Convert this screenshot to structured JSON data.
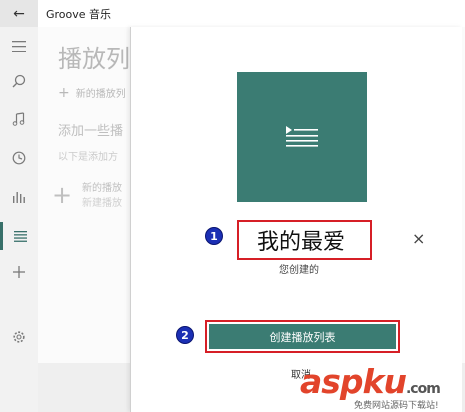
{
  "titlebar": {
    "back_glyph": "←",
    "app_title": "Groove 音乐"
  },
  "rail": {
    "icons": [
      "hamburger-icon",
      "search-icon",
      "music-note-icon",
      "clock-icon",
      "bar-chart-icon",
      "playlist-icon",
      "plus-icon",
      "gear-icon"
    ]
  },
  "background": {
    "title": "播放列",
    "new_playlist": "新的播放列",
    "add_heading": "添加一些播",
    "add_desc": "以下是添加方",
    "item_title": "新的播放",
    "item_sub": "新建播放"
  },
  "dialog": {
    "name_value": "我的最爱",
    "creator_label": "您创建的",
    "create_button": "创建播放列表",
    "cancel_label": "取消",
    "close_glyph": "×",
    "cover_color": "#3b7c73"
  },
  "annotations": {
    "step1": "1",
    "step2": "2",
    "highlight_color": "#d61f26",
    "badge_color": "#1b2fb4"
  },
  "watermark": {
    "text": "aspku",
    "suffix": ".com",
    "sub": "免费网站源码下载站!"
  }
}
